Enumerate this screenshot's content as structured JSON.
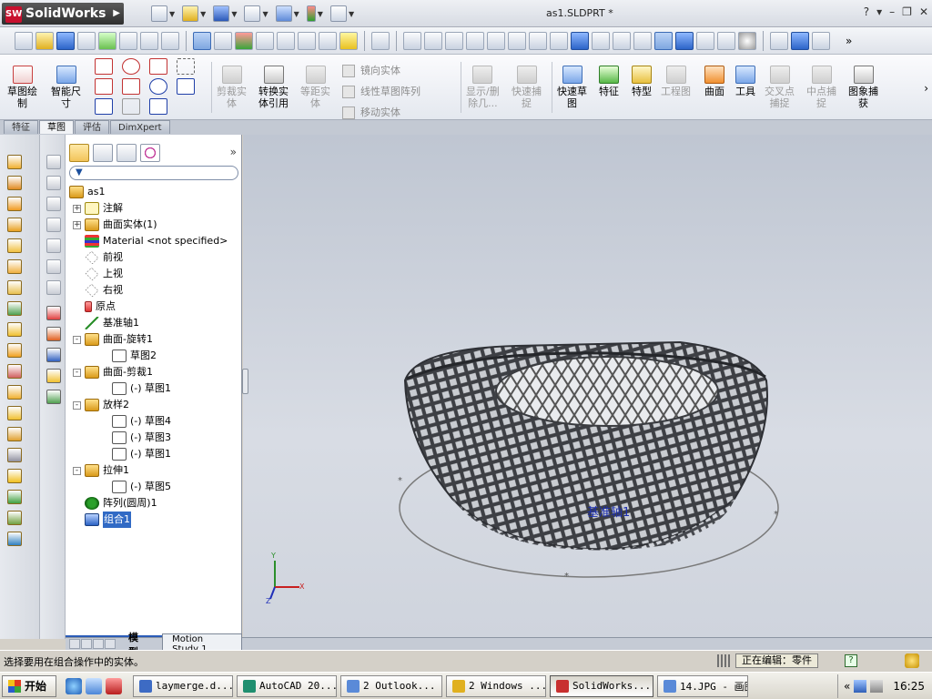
{
  "app": {
    "logo_text": "SolidWorks",
    "logo_badge": "SW",
    "window_title": "as1.SLDPRT *",
    "help_label": "?"
  },
  "command_manager": {
    "sketch": "草图绘\n制",
    "smart_dim": "智能尺\n寸",
    "trim": "剪裁实\n体",
    "convert": "转换实\n体引用",
    "offset": "等距实\n体",
    "mirror": "镜向实体",
    "linear_pattern": "线性草图阵列",
    "move": "移动实体",
    "show_hide": "显示/删\n除几...",
    "quick_snap": "快速捕\n捉",
    "rapid_sketch": "快速草\n图",
    "features": "特征",
    "feature_type": "特型",
    "drawing": "工程图",
    "surface": "曲面",
    "tools": "工具",
    "intersect": "交叉点\n捕捉",
    "midpoint": "中点捕\n捉",
    "capture": "图象捕\n获"
  },
  "tabs": [
    "特征",
    "草图",
    "评估",
    "DimXpert"
  ],
  "active_tab": 1,
  "tree": {
    "root": "as1",
    "items": [
      {
        "label": "注解",
        "icon": "annotation-icon",
        "expand": "+"
      },
      {
        "label": "曲面实体(1)",
        "icon": "surface-body-icon",
        "expand": "+"
      },
      {
        "label": "Material <not specified>",
        "icon": "material-icon",
        "expand": ""
      },
      {
        "label": "前视",
        "icon": "plane-icon",
        "expand": ""
      },
      {
        "label": "上视",
        "icon": "plane-icon",
        "expand": ""
      },
      {
        "label": "右视",
        "icon": "plane-icon",
        "expand": ""
      },
      {
        "label": "原点",
        "icon": "origin-icon",
        "expand": ""
      },
      {
        "label": "基准轴1",
        "icon": "axis-icon",
        "expand": ""
      },
      {
        "label": "曲面-旋转1",
        "icon": "revolve-surface-icon",
        "expand": "-"
      },
      {
        "label": "草图2",
        "icon": "sketch-icon",
        "expand": "",
        "child": true
      },
      {
        "label": "曲面-剪裁1",
        "icon": "trim-surface-icon",
        "expand": "-"
      },
      {
        "label": "(-) 草图1",
        "icon": "sketch-icon",
        "expand": "",
        "child": true
      },
      {
        "label": "放样2",
        "icon": "loft-icon",
        "expand": "-"
      },
      {
        "label": "(-) 草图4",
        "icon": "sketch-icon",
        "expand": "",
        "child": true
      },
      {
        "label": "(-) 草图3",
        "icon": "sketch-icon",
        "expand": "",
        "child": true
      },
      {
        "label": "(-) 草图1",
        "icon": "sketch-icon",
        "expand": "",
        "child": true
      },
      {
        "label": "拉伸1",
        "icon": "extrude-icon",
        "expand": "-"
      },
      {
        "label": "(-) 草图5",
        "icon": "sketch-icon",
        "expand": "",
        "child": true
      },
      {
        "label": "阵列(圆周)1",
        "icon": "circular-pattern-icon",
        "expand": ""
      },
      {
        "label": "组合1",
        "icon": "combine-icon",
        "expand": "",
        "selected": true
      }
    ]
  },
  "tree_tabs": {
    "model": "模型",
    "motion": "Motion Study 1"
  },
  "viewport": {
    "axis_label": "基准轴1",
    "triad": {
      "x": "X",
      "y": "Y",
      "z": "Z"
    }
  },
  "status": {
    "message": "选择要用在组合操作中的实体。",
    "editing": "正在编辑：零件",
    "help": "?"
  },
  "taskbar": {
    "start": "开始",
    "items": [
      {
        "label": "laymerge.d...",
        "active": false
      },
      {
        "label": "AutoCAD 20...",
        "active": false
      },
      {
        "label": "2 Outlook...",
        "active": false
      },
      {
        "label": "2 Windows ...",
        "active": false
      },
      {
        "label": "SolidWorks...",
        "active": true
      },
      {
        "label": "14.JPG - 画图",
        "active": false
      }
    ],
    "clock": "16:25",
    "tray_chevron": "«"
  },
  "colors": {
    "selection": "#316ac5",
    "viewport_top": "#bfc6d2",
    "axis_text": "#1c2fb0"
  }
}
